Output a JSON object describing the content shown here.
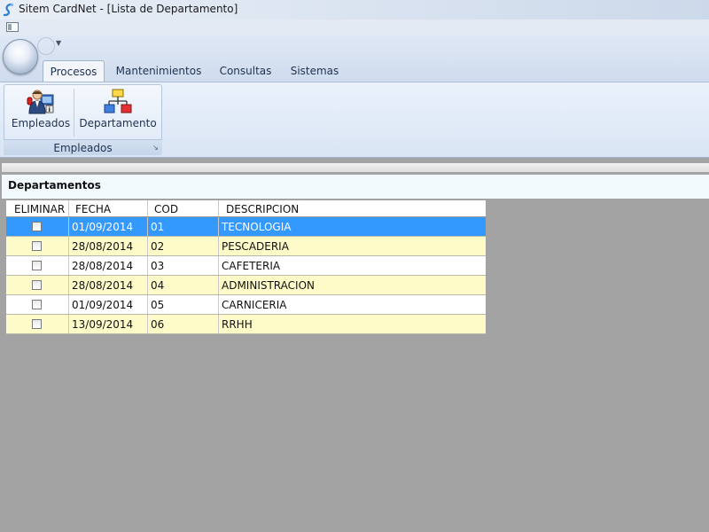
{
  "window": {
    "title": "Sitem CardNet - [Lista de Departamento]"
  },
  "ribbon": {
    "tabs": [
      {
        "label": "Procesos",
        "active": true
      },
      {
        "label": "Mantenimientos",
        "active": false
      },
      {
        "label": "Consultas",
        "active": false
      },
      {
        "label": "Sistemas",
        "active": false
      }
    ],
    "group_label": "Empleados",
    "buttons": [
      {
        "label": "Empleados",
        "icon": "employee-icon"
      },
      {
        "label": "Departamento",
        "icon": "org-chart-icon"
      }
    ]
  },
  "form": {
    "title": "Departamentos"
  },
  "grid": {
    "columns": [
      "ELIMINAR",
      "FECHA",
      "COD",
      "DESCRIPCION"
    ],
    "rows": [
      {
        "fecha": "01/09/2014",
        "cod": "01",
        "descripcion": "TECNOLOGIA",
        "eliminar": false,
        "selected": true
      },
      {
        "fecha": "28/08/2014",
        "cod": "02",
        "descripcion": "PESCADERIA",
        "eliminar": false,
        "selected": false
      },
      {
        "fecha": "28/08/2014",
        "cod": "03",
        "descripcion": "CAFETERIA",
        "eliminar": false,
        "selected": false
      },
      {
        "fecha": "28/08/2014",
        "cod": "04",
        "descripcion": "ADMINISTRACION",
        "eliminar": false,
        "selected": false
      },
      {
        "fecha": "01/09/2014",
        "cod": "05",
        "descripcion": "CARNICERIA",
        "eliminar": false,
        "selected": false
      },
      {
        "fecha": "13/09/2014",
        "cod": "06",
        "descripcion": "RRHH",
        "eliminar": false,
        "selected": false
      }
    ]
  },
  "colors": {
    "selected_row": "#3399ff",
    "alt_row": "#fefbc8",
    "row": "#ffffff",
    "workspace": "#a3a3a3"
  }
}
